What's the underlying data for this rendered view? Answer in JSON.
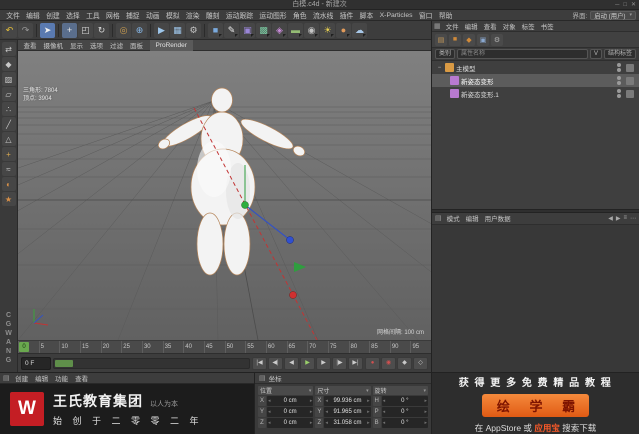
{
  "window": {
    "title": "白模.c4d - 新建次",
    "min": "─",
    "max": "□",
    "close": "✕"
  },
  "menubar": {
    "items": [
      "文件",
      "编辑",
      "创建",
      "选择",
      "工具",
      "网格",
      "捕捉",
      "动画",
      "模拟",
      "渲染",
      "雕刻",
      "运动跟踪",
      "运动图形",
      "角色",
      "流水线",
      "插件",
      "脚本",
      "X-Particles",
      "窗口",
      "帮助"
    ],
    "interface_label": "界面:",
    "interface_value": "启动 (用户)"
  },
  "toolbar": {
    "icons": [
      {
        "name": "undo-icon",
        "glyph": "↶",
        "color": "#e8c23a"
      },
      {
        "name": "redo-icon",
        "glyph": "↷",
        "color": "#999999"
      },
      {
        "sep": true
      },
      {
        "name": "live-selection-icon",
        "glyph": "➤",
        "color": "#f0f0f0",
        "bg": "#5a7ab0"
      },
      {
        "sep": true
      },
      {
        "name": "move-icon",
        "glyph": "+",
        "color": "#e8e8e8",
        "bg": "#5a6e8c"
      },
      {
        "name": "scale-icon",
        "glyph": "◰",
        "color": "#d8d8d8"
      },
      {
        "name": "rotate-icon",
        "glyph": "↻",
        "color": "#d8d8d8"
      },
      {
        "sep": true
      },
      {
        "name": "last-tool-icon",
        "glyph": "◎",
        "color": "#d0a050"
      },
      {
        "name": "coord-system-icon",
        "glyph": "⊕",
        "color": "#84b4e4"
      },
      {
        "sep": true
      },
      {
        "name": "render-view-icon",
        "glyph": "▶",
        "color": "#9ec6ea"
      },
      {
        "name": "render-picture-viewer-icon",
        "glyph": "▦",
        "color": "#9ec6ea"
      },
      {
        "name": "render-settings-icon",
        "glyph": "⚙",
        "color": "#c8c8c8"
      },
      {
        "sep": true
      },
      {
        "name": "add-cube-icon",
        "glyph": "■",
        "color": "#7aaade",
        "dropdown": true
      },
      {
        "name": "spline-pen-icon",
        "glyph": "✎",
        "color": "#ececec",
        "dropdown": true
      },
      {
        "name": "subdivision-surface-icon",
        "glyph": "▣",
        "color": "#9a86d8",
        "dropdown": true
      },
      {
        "name": "array-icon",
        "glyph": "▩",
        "color": "#7ac8a0",
        "dropdown": true
      },
      {
        "name": "deformer-icon",
        "glyph": "◈",
        "color": "#c88ad8",
        "dropdown": true
      },
      {
        "name": "floor-icon",
        "glyph": "▬",
        "color": "#94bc74",
        "dropdown": true
      },
      {
        "name": "camera-icon",
        "glyph": "◉",
        "color": "#c4c4c4",
        "dropdown": true
      },
      {
        "name": "light-icon",
        "glyph": "☀",
        "color": "#e8d050",
        "dropdown": true
      },
      {
        "name": "material-icon",
        "glyph": "●",
        "color": "#e09a5a",
        "dropdown": true
      },
      {
        "name": "sky-icon",
        "glyph": "☁",
        "color": "#a8c8e8",
        "dropdown": true
      }
    ]
  },
  "left_strip": {
    "icons": [
      {
        "name": "make-editable-icon",
        "glyph": "⇄",
        "color": "#c8c8c8"
      },
      {
        "name": "model-mode-icon",
        "glyph": "◆",
        "color": "#c8c8c8"
      },
      {
        "name": "texture-mode-icon",
        "glyph": "▨",
        "color": "#c8c8c8"
      },
      {
        "name": "workplane-mode-icon",
        "glyph": "▱",
        "color": "#c8c8c8"
      },
      {
        "name": "points-mode-icon",
        "glyph": "∴",
        "color": "#c8c8c8"
      },
      {
        "name": "edges-mode-icon",
        "glyph": "╱",
        "color": "#c8c8c8"
      },
      {
        "name": "polygons-mode-icon",
        "glyph": "△",
        "color": "#c8c8c8"
      },
      {
        "name": "enable-axis-icon",
        "glyph": "+",
        "color": "#d8a850"
      },
      {
        "name": "snap-icon",
        "glyph": "≈",
        "color": "#c8c8c8"
      },
      {
        "name": "viewport-solo-icon",
        "glyph": "◐",
        "color": "#d89048"
      },
      {
        "name": "plugin-icon",
        "glyph": "★",
        "color": "#d89048"
      }
    ],
    "watermark": "CGWANG"
  },
  "viewport": {
    "menus": [
      "查看",
      "摄像机",
      "显示",
      "选项",
      "过滤",
      "面板"
    ],
    "prorender_tab": "ProRender",
    "hud_lines": [
      "三角形: 7804",
      "顶点: 3904"
    ],
    "grid_label": "网格间隔: 100 cm"
  },
  "ruler": {
    "playhead": "0",
    "ticks": [
      "0",
      "5",
      "10",
      "15",
      "20",
      "25",
      "30",
      "35",
      "40",
      "45",
      "50",
      "55",
      "60",
      "65",
      "70",
      "75",
      "80",
      "85",
      "90",
      "95"
    ]
  },
  "transport": {
    "frame_field": "0 F",
    "playback": [
      {
        "name": "goto-start-button",
        "glyph": "|◀"
      },
      {
        "name": "prev-key-button",
        "glyph": "◀|"
      },
      {
        "name": "prev-frame-button",
        "glyph": "◀"
      },
      {
        "name": "play-button",
        "glyph": "▶",
        "color": "#9ad06a"
      },
      {
        "name": "next-frame-button",
        "glyph": "▶"
      },
      {
        "name": "next-key-button",
        "glyph": "|▶"
      },
      {
        "name": "goto-end-button",
        "glyph": "▶|"
      }
    ],
    "record": [
      {
        "name": "record-keyframe-button",
        "glyph": "●",
        "color": "#d05050"
      },
      {
        "name": "autokey-button",
        "glyph": "◉",
        "color": "#d05050"
      },
      {
        "name": "key-filter-position-button",
        "glyph": "◆",
        "color": "#c8c8c8"
      },
      {
        "name": "key-filter-rotation-button",
        "glyph": "◇",
        "color": "#c8c8c8"
      }
    ]
  },
  "objects_panel": {
    "menus": [
      "文件",
      "编辑",
      "查看",
      "对象",
      "标签",
      "书签"
    ],
    "toolbar_icons": [
      {
        "name": "om-layer-icon",
        "glyph": "▤",
        "color": "#c89a5a"
      },
      {
        "name": "om-object-icon",
        "glyph": "■",
        "color": "#d08a3a"
      },
      {
        "name": "om-character-icon",
        "glyph": "◆",
        "color": "#d08a3a"
      },
      {
        "name": "om-tag-icon",
        "glyph": "▣",
        "color": "#8aa8d0"
      },
      {
        "name": "om-settings-icon",
        "glyph": "⚙",
        "color": "#b0b0b0"
      }
    ],
    "filter": {
      "category": "类别",
      "name_placeholder": "属性名称",
      "v": "V",
      "tag": "结构标签"
    },
    "tree": [
      {
        "label": "主模型",
        "expander": "−",
        "icon_style": "background:#d99a44"
      },
      {
        "label": "新姿态变形",
        "icon_style": "background:#b87ad0"
      },
      {
        "label": "新姿态变形.1",
        "icon_style": "background:#b87ad0"
      }
    ]
  },
  "attributes_panel": {
    "menus": [
      "模式",
      "编辑",
      "用户数据"
    ],
    "nav": [
      {
        "name": "am-back-icon",
        "glyph": "◀"
      },
      {
        "name": "am-forward-icon",
        "glyph": "▶"
      },
      {
        "name": "am-list-icon",
        "glyph": "≡"
      },
      {
        "name": "am-more-icon",
        "glyph": "⋯"
      }
    ]
  },
  "material_panel": {
    "menus": [
      "创建",
      "编辑",
      "功能",
      "查看"
    ]
  },
  "coord_panel": {
    "title": "坐标",
    "groups": [
      {
        "header": "位置",
        "rows": [
          {
            "axis": "X",
            "value": "0 cm"
          },
          {
            "axis": "Y",
            "value": "0 cm"
          },
          {
            "axis": "Z",
            "value": "0 cm"
          }
        ]
      },
      {
        "header": "尺寸",
        "rows": [
          {
            "axis": "X",
            "value": "99.936 cm"
          },
          {
            "axis": "Y",
            "value": "91.965 cm"
          },
          {
            "axis": "Z",
            "value": "31.058 cm"
          }
        ]
      },
      {
        "header": "旋转",
        "rows": [
          {
            "axis": "H",
            "value": "0 °"
          },
          {
            "axis": "P",
            "value": "0 °"
          },
          {
            "axis": "B",
            "value": "0 °"
          }
        ]
      }
    ]
  },
  "brand": {
    "logo_text": "W",
    "name": "王氏教育集团",
    "tagline": "以人为本",
    "slogan": "始 创 于 二 零 零 二 年"
  },
  "ad_panel": {
    "line1": "获 得 更 多 免 费 精 品 教 程",
    "badge": "绘 学 霸",
    "line3_prefix": "在 AppStore 或",
    "line3_highlight": "应用宝",
    "line3_suffix": "搜索下载"
  }
}
